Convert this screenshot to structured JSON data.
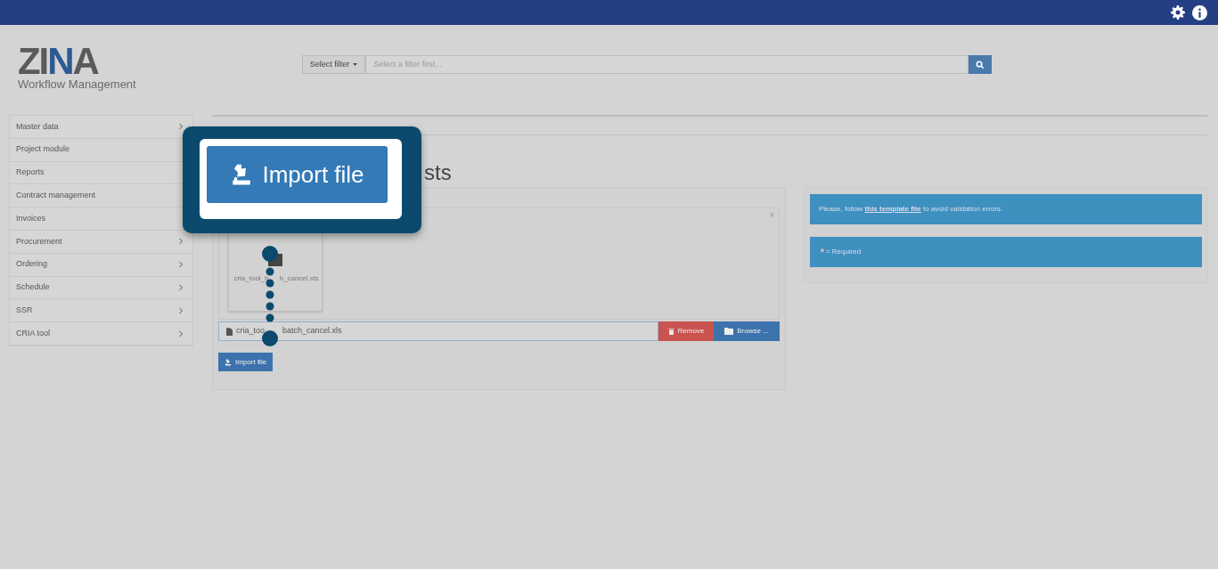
{
  "logo": {
    "text": "ZINA",
    "subtitle": "Workflow Management"
  },
  "search": {
    "filter_label": "Select filter",
    "placeholder": "Select a filter first..."
  },
  "sidebar": {
    "items": [
      {
        "label": "Master data",
        "chevron": true
      },
      {
        "label": "Project module",
        "chevron": false
      },
      {
        "label": "Reports",
        "chevron": false
      },
      {
        "label": "Contract management",
        "chevron": false
      },
      {
        "label": "Invoices",
        "chevron": false
      },
      {
        "label": "Procurement",
        "chevron": true
      },
      {
        "label": "Ordering",
        "chevron": true
      },
      {
        "label": "Schedule",
        "chevron": true
      },
      {
        "label": "SSR",
        "chevron": true
      },
      {
        "label": "CRIA tool",
        "chevron": true
      }
    ]
  },
  "page_title": "sts",
  "upload": {
    "thumbnail_caption_parts": [
      "cria_tool_b",
      "h_cancel.xls"
    ],
    "file_name_parts": [
      "cria_too",
      "batch_cancel.xls"
    ],
    "close": "×",
    "remove": "Remove",
    "browse": "Browse ...",
    "import": "Import file"
  },
  "info": {
    "template_note_before": "Please, follow",
    "template_link": "this template file",
    "template_note_after": "to avoid validation errors.",
    "required_mark": "*",
    "required_note": "= Required"
  },
  "callout": {
    "button": "Import file"
  }
}
